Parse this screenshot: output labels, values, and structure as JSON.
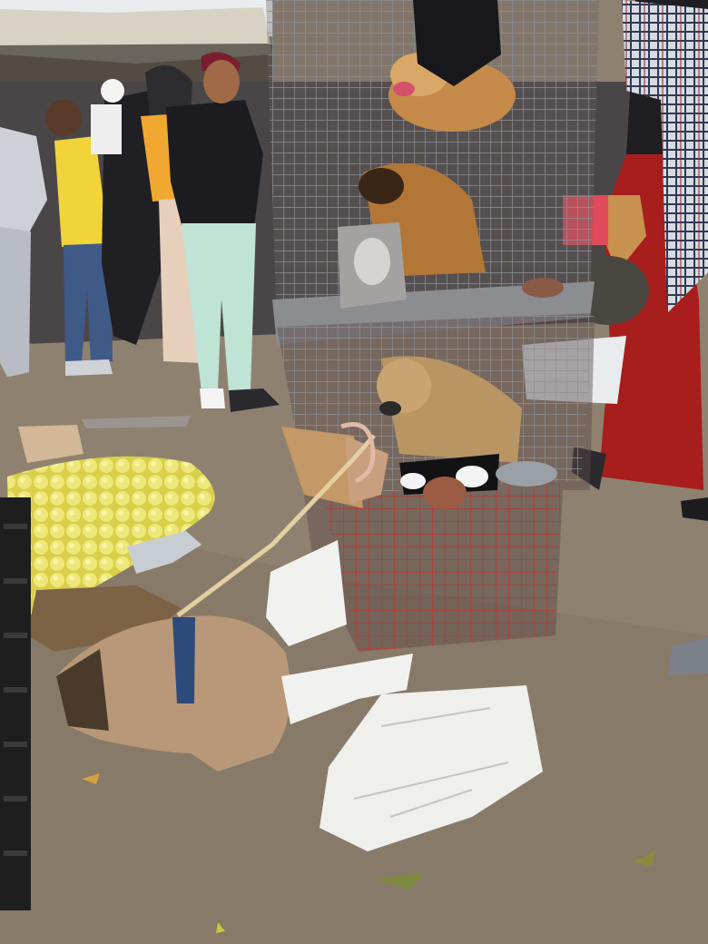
{
  "scene": {
    "palette": {
      "sky": "#e9ecef",
      "ground": "#8f8170",
      "ground_dark": "#7a6c5b",
      "tent": "#d8d2c4",
      "crowd_dark": "#2a2a30",
      "yellow_shirt": "#f0d43a",
      "black_shirt": "#1c1c20",
      "mint_jeans": "#bfe3d4",
      "red_robe": "#a81e1c",
      "plaid": "#c9cfd8",
      "cage_grey": "#8c9096",
      "cage_red": "#a8453e",
      "puppy_tan": "#c68a4a",
      "puppy_shaggy": "#b89563",
      "lemon": "#e3dd62",
      "plastic_white": "#f1f1ef",
      "leash_rope": "#e3cfa0",
      "crate_black": "#1e1e1e"
    }
  }
}
